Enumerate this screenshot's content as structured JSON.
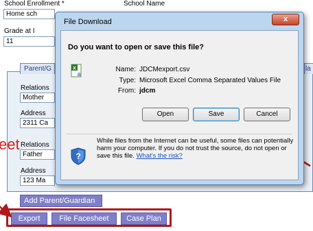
{
  "form": {
    "school_enrollment_label": "School Enrollment *",
    "school_enrollment_value": "Home sch",
    "school_name_label": "School Name",
    "grade_label": "Grade at I",
    "grade_value": "11",
    "tab_parent": "Parent/G",
    "tab_right": "la",
    "relationship_label_1": "Relations",
    "relationship_value_1": "Mother",
    "address_label_1": "Address",
    "address_value_1": "2311 Ca",
    "relationship_label_2": "Relations",
    "relationship_value_2": "Father",
    "address_label_2": "Address",
    "address_value_2": "123 Ma",
    "add_parent_button": "Add Parent/Guardian",
    "red_fragment": "eet"
  },
  "actions": {
    "export": "Export",
    "file_facesheet": "File Facesheet",
    "case_plan": "Case Plan"
  },
  "dialog": {
    "title": "File Download",
    "close_glyph": "x",
    "question": "Do you want to open or save this file?",
    "name_label": "Name:",
    "name_value": "JDCMexport.csv",
    "type_label": "Type:",
    "type_value": "Microsoft Excel Comma Separated Values File",
    "from_label": "From:",
    "from_value": "jdcm",
    "open_button": "Open",
    "save_button": "Save",
    "cancel_button": "Cancel",
    "warning_text": "While files from the Internet can be useful, some files can potentially harm your computer. If you do not trust the source, do not open or save this file.",
    "warning_link": "What's the risk?"
  },
  "colors": {
    "highlight": "#b01818",
    "action_button": "#7f7fc9",
    "dialog_frame": "#bcd6ef"
  },
  "icons": {
    "file_icon": "excel-csv-file-icon",
    "shield_icon": "security-shield-icon",
    "close_icon": "close-icon"
  }
}
